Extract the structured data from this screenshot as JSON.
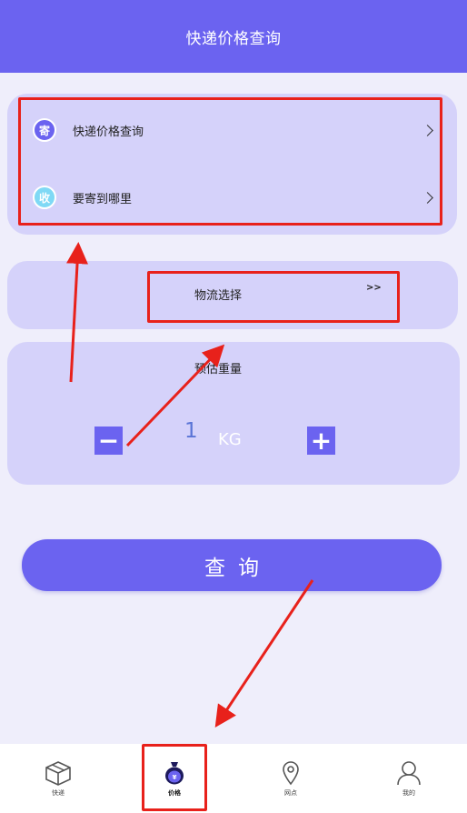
{
  "header": {
    "title": "快递价格查询"
  },
  "route": {
    "send": {
      "badge": "寄",
      "label": "快递价格查询"
    },
    "receive": {
      "badge": "收",
      "label": "要寄到哪里"
    }
  },
  "logistics": {
    "label": "物流选择",
    "arrows": ">>"
  },
  "weight": {
    "title": "预估重量",
    "value": "1",
    "unit": "KG",
    "minus": "−",
    "plus": "+"
  },
  "query_button": {
    "label": "查询"
  },
  "tabbar": {
    "tabs": [
      {
        "label": "快递",
        "icon": "box-icon",
        "active": false
      },
      {
        "label": "价格",
        "icon": "money-bag-icon",
        "active": true
      },
      {
        "label": "网点",
        "icon": "location-pin-icon",
        "active": false
      },
      {
        "label": "我的",
        "icon": "user-icon",
        "active": false
      }
    ]
  },
  "colors": {
    "primary": "#6b63f0",
    "card": "#d5d2fa",
    "background": "#efeefb",
    "annotation": "#e8211b",
    "receive_badge": "#7fd9f5",
    "weight_value": "#5a74d6"
  }
}
